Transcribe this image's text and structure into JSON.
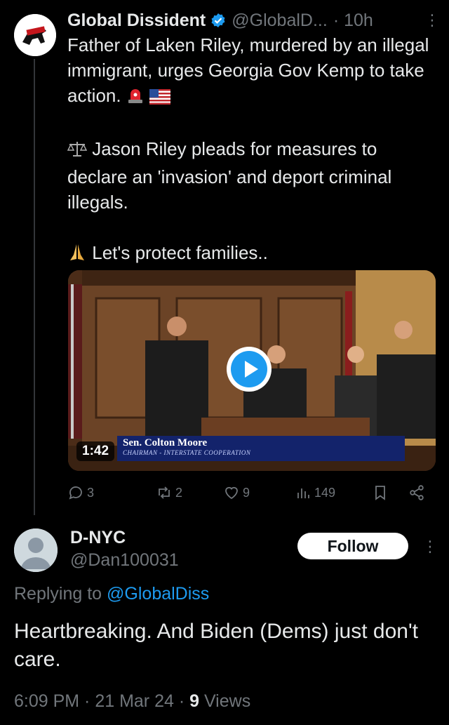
{
  "tweet": {
    "author_name": "Global Dissident",
    "author_handle": "@GlobalD...",
    "time": "· 10h",
    "more": "⋮",
    "line1": "Father of Laken Riley, murdered by an illegal immigrant, urges Georgia Gov Kemp to take action.",
    "line2": "Jason Riley pleads for measures to declare an 'invasion' and deport criminal illegals.",
    "line3": "Let's protect families..",
    "video": {
      "duration": "1:42",
      "caption_name": "Sen. Colton Moore",
      "caption_title": "CHAIRMAN - INTERSTATE COOPERATION"
    },
    "stats": {
      "replies": "3",
      "reposts": "2",
      "likes": "9",
      "views": "149"
    }
  },
  "reply": {
    "author_name": "D-NYC",
    "author_handle": "@Dan100031",
    "follow_label": "Follow",
    "more": "⋮",
    "replying_prefix": "Replying to ",
    "replying_mention": "@GlobalDiss",
    "text": "Heartbreaking. And Biden (Dems) just don't care.",
    "time_date": "6:09 PM · 21 Mar 24 · ",
    "views_count": "9",
    "views_label": " Views"
  },
  "colors": {
    "background": "#000000",
    "text": "#e7e9ea",
    "muted": "#71767b",
    "accent": "#1d9bf0"
  }
}
